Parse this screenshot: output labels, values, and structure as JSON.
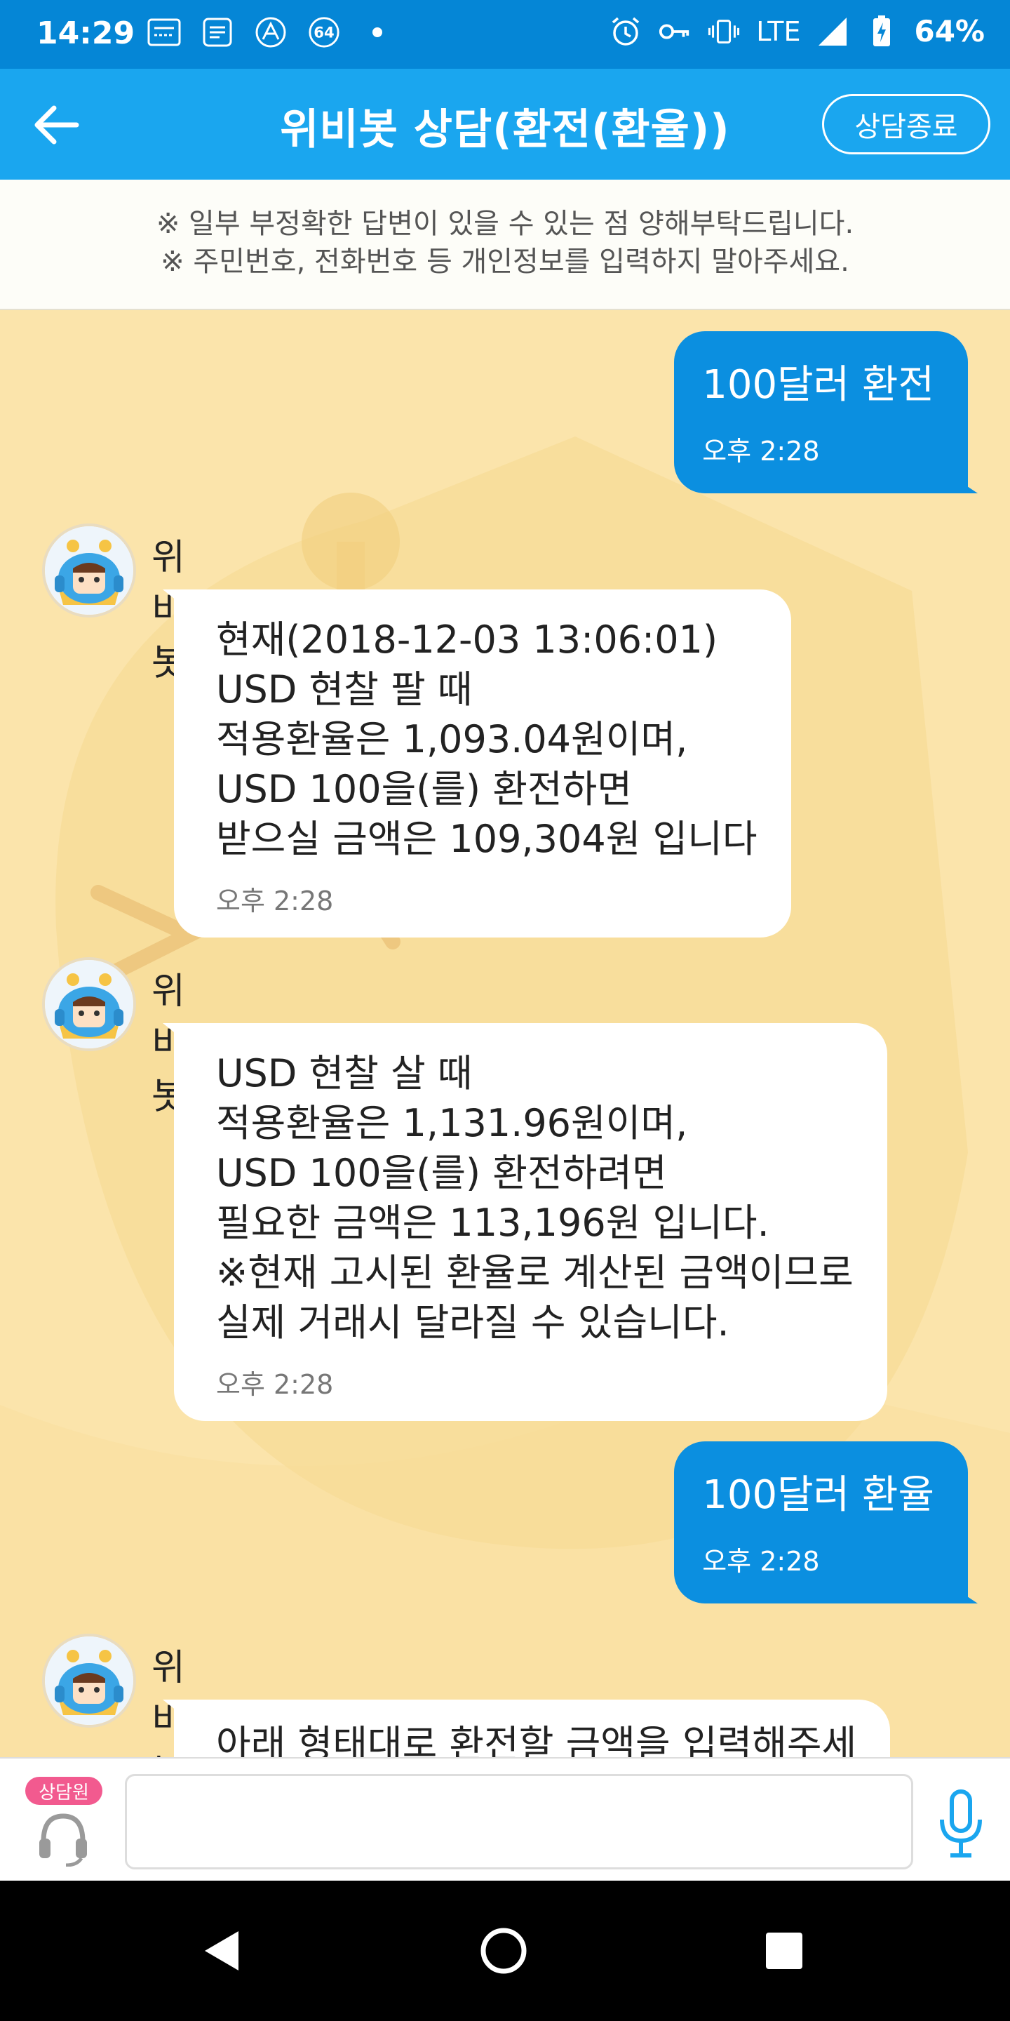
{
  "status_bar": {
    "time": "14:29",
    "badge_number": "64",
    "network": "LTE",
    "battery": "64%"
  },
  "app_bar": {
    "title": "위비봇 상담(환전(환율))",
    "end_button": "상담종료"
  },
  "notice": {
    "line1": "※ 일부 부정확한 답변이 있을 수 있는 점 양해부탁드립니다.",
    "line2": "※ 주민번호, 전화번호 등 개인정보를 입력하지 말아주세요."
  },
  "messages": [
    {
      "type": "user",
      "text": "100달러 환전",
      "time": "오후 2:28"
    },
    {
      "type": "bot",
      "name": "위비봇",
      "lines": [
        "현재(2018-12-03 13:06:01)",
        "USD 현찰 팔 때",
        "적용환율은 1,093.04원이며,",
        "USD 100을(를) 환전하면",
        "받으실 금액은 109,304원 입니다"
      ],
      "time": "오후 2:28"
    },
    {
      "type": "bot",
      "name": "위비봇",
      "lines": [
        "USD 현찰 살 때",
        "적용환율은 1,131.96원이며,",
        "USD 100을(를) 환전하려면",
        "필요한 금액은 113,196원 입니다.",
        "※현재 고시된 환율로 계산된 금액이므로",
        "실제 거래시 달라질 수 있습니다."
      ],
      "time": "오후 2:28"
    },
    {
      "type": "user",
      "text": "100달러 환율",
      "time": "오후 2:28"
    },
    {
      "type": "bot",
      "name": "위비봇",
      "lines": [
        "아래 형태대로 환전할 금액을 입력해주세"
      ],
      "time": ""
    }
  ],
  "input_bar": {
    "agent_badge": "상담원",
    "placeholder": ""
  },
  "colors": {
    "status_bar": "#0586d6",
    "app_bar": "#1aa6ef",
    "chat_bg": "#fbe4ab",
    "user_bubble": "#0b8fe0",
    "agent_badge": "#f25a8f"
  }
}
